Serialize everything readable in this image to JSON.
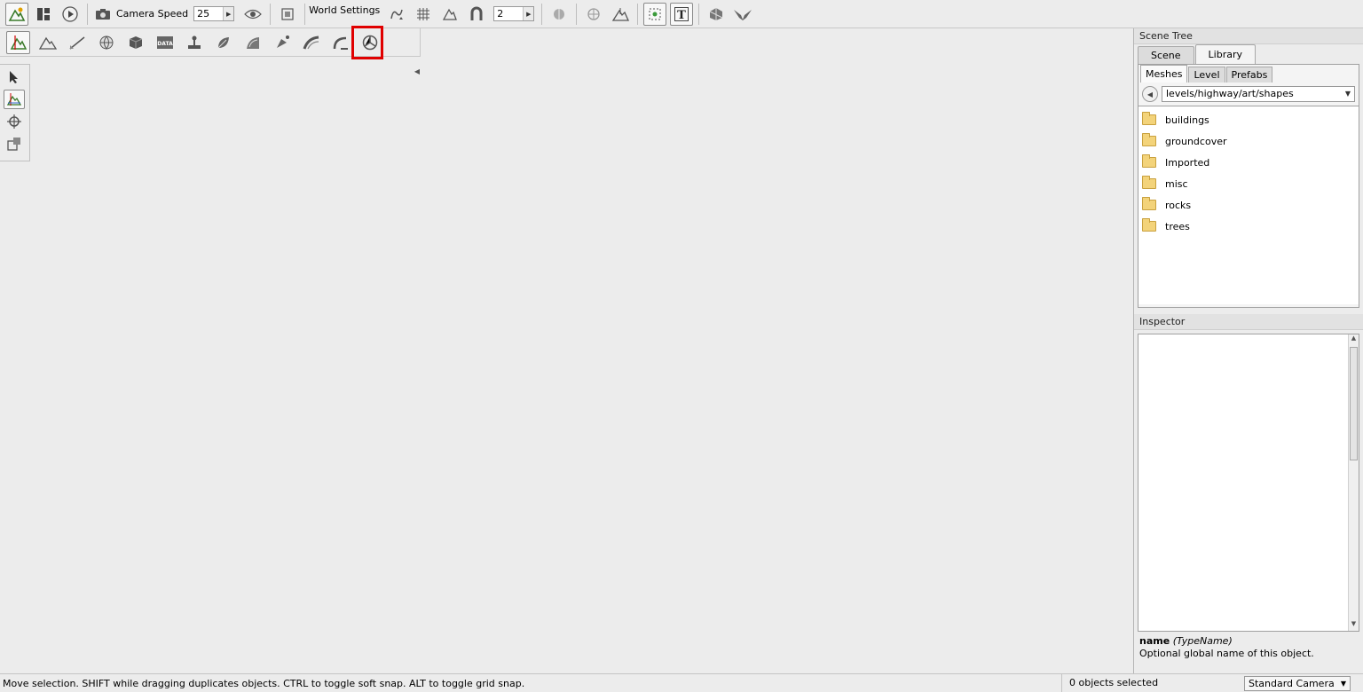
{
  "top_toolbar": {
    "camera_speed_label": "Camera Speed",
    "camera_speed_value": "25",
    "world_settings_label": "World Settings",
    "snap_value": "2"
  },
  "scene_tree": {
    "title": "Scene Tree",
    "tabs": [
      {
        "label": "Scene",
        "active": false
      },
      {
        "label": "Library",
        "active": true
      }
    ],
    "subtabs": [
      {
        "label": "Meshes",
        "active": true
      },
      {
        "label": "Level",
        "active": false
      },
      {
        "label": "Prefabs",
        "active": false
      }
    ],
    "path": "levels/highway/art/shapes",
    "folders": [
      "buildings",
      "groundcover",
      "Imported",
      "misc",
      "rocks",
      "trees"
    ]
  },
  "inspector": {
    "title": "Inspector",
    "field_name": "name",
    "field_type": "(TypeName)",
    "description": "Optional global name of this object."
  },
  "status_bar": {
    "message": "Move selection.  SHIFT while dragging duplicates objects.  CTRL to toggle soft snap.  ALT to toggle grid snap.",
    "selection_count": "0 objects selected",
    "camera_mode": "Standard Camera"
  },
  "colors": {
    "highlight": "#e00000",
    "sky_top": "#6f92bc",
    "sky_horizon": "#dfe8f1",
    "ground": "#9aa0a5",
    "road": "#4c5157",
    "folder": "#f3d37a"
  }
}
